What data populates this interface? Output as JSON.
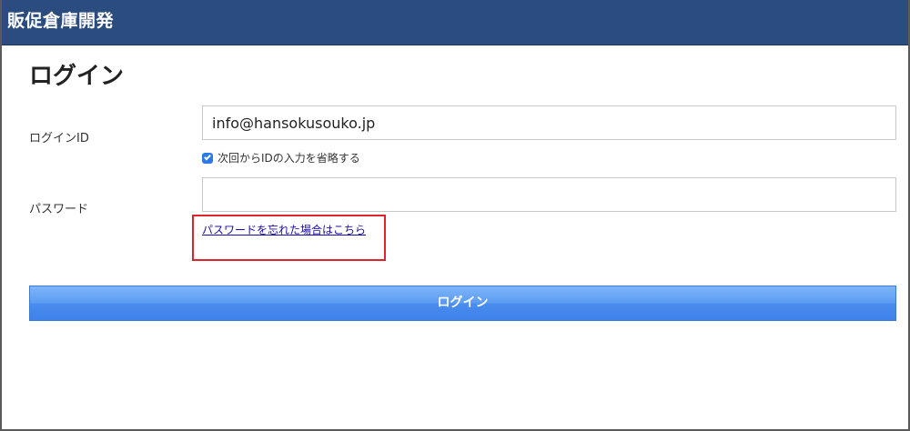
{
  "header": {
    "title": "販促倉庫開発"
  },
  "page": {
    "title": "ログイン"
  },
  "form": {
    "login_id_label": "ログインID",
    "login_id_value": "info@hansokusouko.jp",
    "remember_label": "次回からIDの入力を省略する",
    "remember_checked": true,
    "password_label": "パスワード",
    "password_value": "",
    "forgot_password_link": "パスワードを忘れた場合はこちら",
    "login_button": "ログイン"
  },
  "colors": {
    "header_bg": "#2a4c7e",
    "button_blue": "#4a8cee",
    "link": "#1a0dab",
    "highlight": "#e0242b"
  }
}
